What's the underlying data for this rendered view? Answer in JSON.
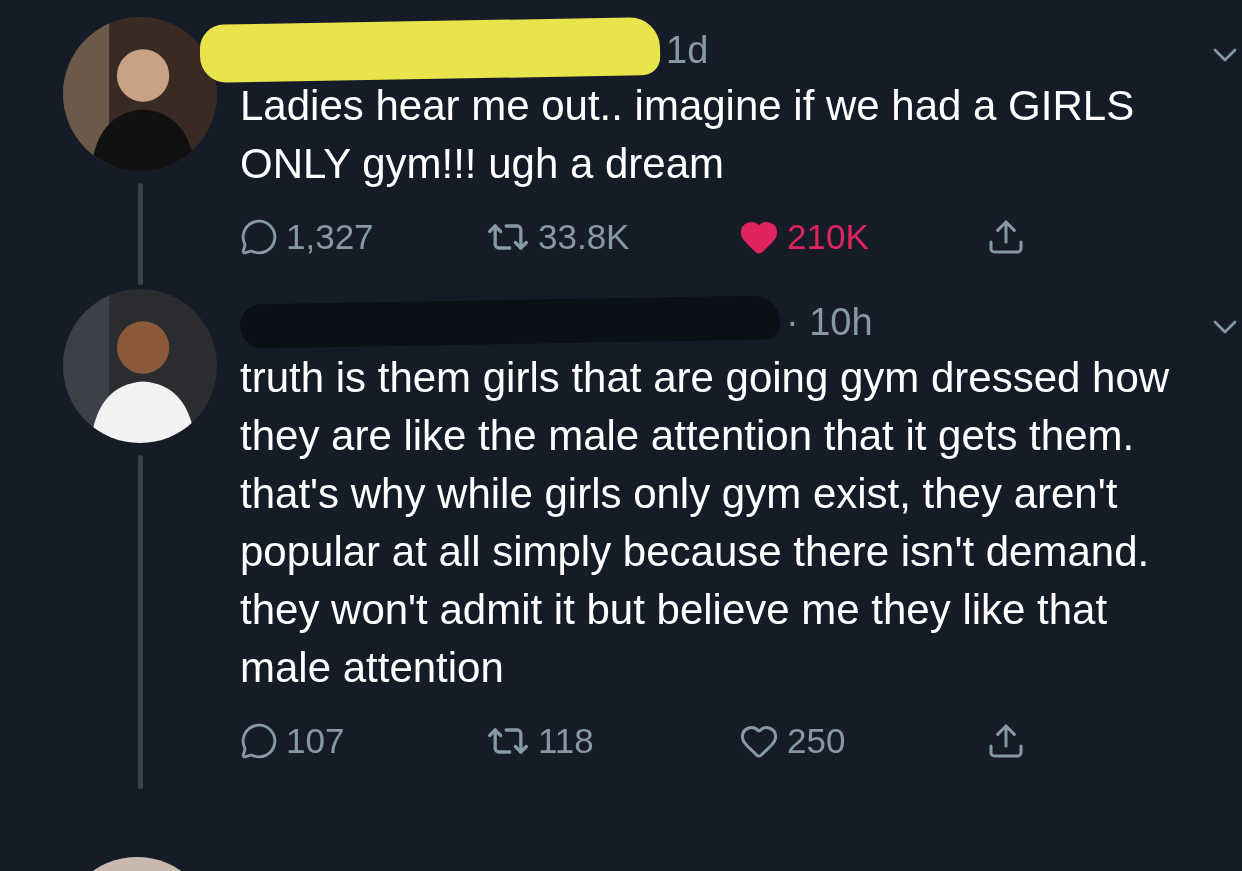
{
  "tweets": [
    {
      "kind": "highlight",
      "time": "1d",
      "text": "Ladies hear me out.. imagine if we had a GIRLS ONLY gym!!! ugh a dream",
      "replies": "1,327",
      "retweets": "33.8K",
      "likes": "210K",
      "liked": true
    },
    {
      "kind": "marker",
      "time": "· 10h",
      "text": "truth is them girls that are going gym dressed how they are like the male attention that it gets them. that's why while girls only gym exist, they aren't popular at all simply because there isn't demand. they won't admit it but believe me they like that male attention",
      "replies": "107",
      "retweets": "118",
      "likes": "250",
      "liked": false
    }
  ]
}
